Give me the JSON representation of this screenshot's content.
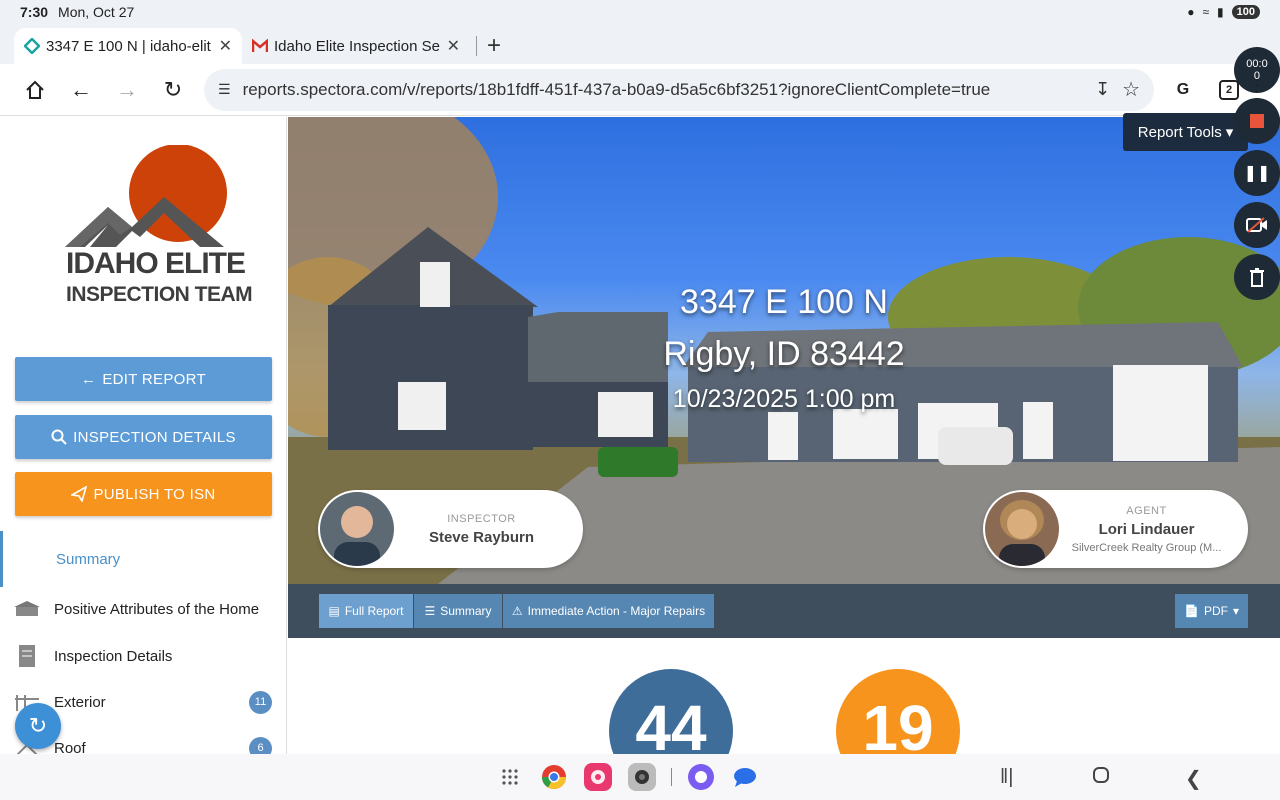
{
  "status_bar": {
    "time": "7:30",
    "date": "Mon, Oct 27",
    "battery": "100"
  },
  "tabs": [
    {
      "title": "3347 E 100 N | idaho-elit",
      "active": true
    },
    {
      "title": "Idaho Elite Inspection Se",
      "active": false
    }
  ],
  "toolbar": {
    "url": "reports.spectora.com/v/reports/18b1fdff-451f-437a-b0a9-d5a5c6bf3251?ignoreClientComplete=true",
    "tab_count": "2"
  },
  "logo": {
    "line1": "IDAHO ELITE",
    "line2": "INSPECTION TEAM"
  },
  "sidebar": {
    "edit_report": "EDIT REPORT",
    "inspection_details": "INSPECTION DETAILS",
    "publish": "PUBLISH TO ISN",
    "summary": "Summary",
    "items": [
      {
        "label": "Positive Attributes of the Home",
        "count": ""
      },
      {
        "label": "Inspection Details",
        "count": ""
      },
      {
        "label": "Exterior",
        "count": "11"
      },
      {
        "label": "Roof",
        "count": "6"
      }
    ]
  },
  "hero": {
    "address_line1": "3347 E 100 N",
    "address_line2": "Rigby, ID 83442",
    "datetime": "10/23/2025 1:00 pm",
    "inspector": {
      "role": "INSPECTOR",
      "name": "Steve Rayburn"
    },
    "agent": {
      "role": "AGENT",
      "name": "Lori Lindauer",
      "org": "SilverCreek Realty Group (M..."
    }
  },
  "report_tools": "Report Tools",
  "report_nav": {
    "full_report": "Full Report",
    "summary": "Summary",
    "immediate": "Immediate Action - Major Repairs",
    "pdf": "PDF"
  },
  "stats": [
    {
      "value": "44",
      "color": "#3f6d99"
    },
    {
      "value": "19",
      "color": "#f7941d"
    }
  ],
  "recorder": {
    "timer_line1": "00:0",
    "timer_line2": "0"
  },
  "colors": {
    "primary_blue": "#5c9bd6",
    "orange": "#f7941d",
    "nav_dark": "#3f4e5c",
    "tools_dark": "#1c2b3d"
  }
}
